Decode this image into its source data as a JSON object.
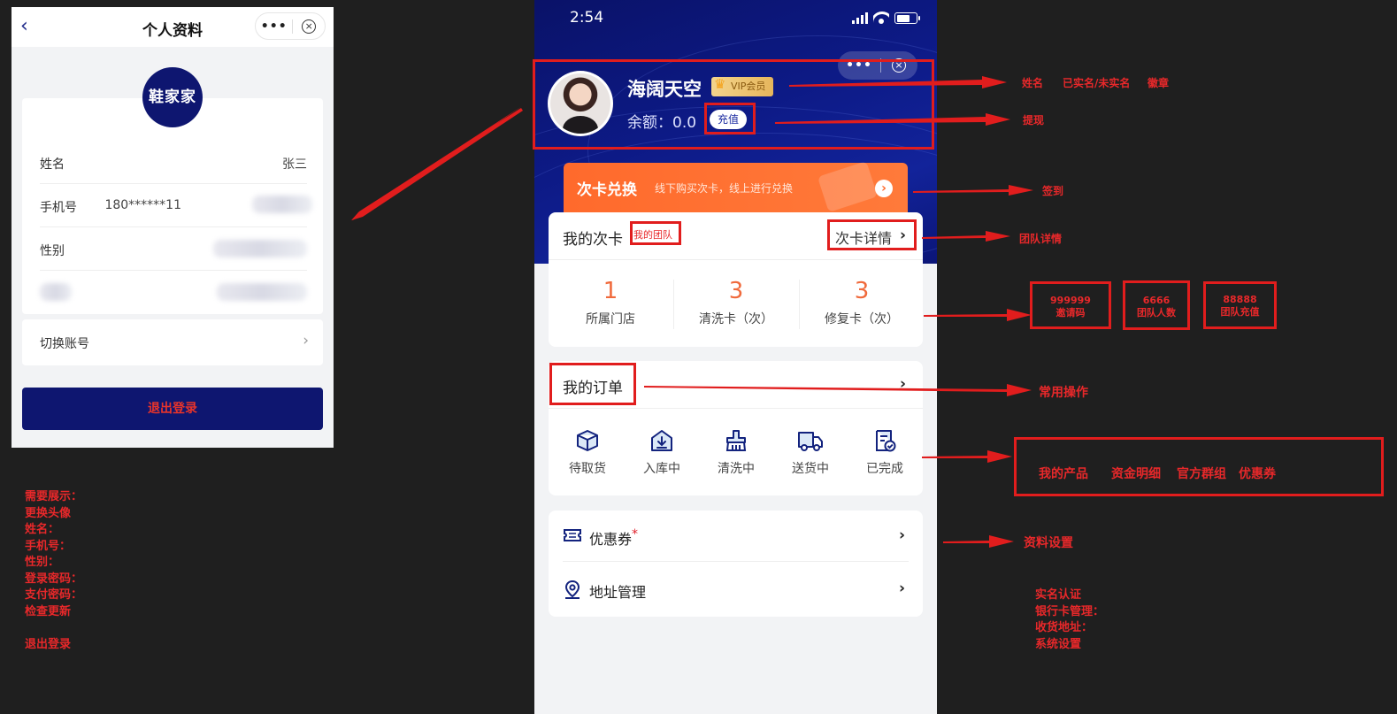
{
  "left_phone": {
    "nav_title": "个人资料",
    "capsule_dots": "•••",
    "capsule_close": "×",
    "back_icon": "‹",
    "logo_text": "鞋家家",
    "fields": [
      {
        "label": "姓名",
        "value": "张三"
      },
      {
        "label": "手机号",
        "value": "180******11"
      },
      {
        "label": "性别",
        "value": ""
      },
      {
        "label": "",
        "value": ""
      }
    ],
    "switch_account": "切换账号",
    "switch_chevron": "›",
    "logout": "退出登录"
  },
  "right_phone": {
    "status": {
      "time": "2:54"
    },
    "capsule_dots": "•••",
    "capsule_close": "×",
    "user": {
      "name": "海阔天空",
      "vip_badge": "VIP会员",
      "balance_label": "余额：",
      "balance_value": "0.0",
      "recharge_button": "充值"
    },
    "promo": {
      "title": "次卡兑换",
      "subtitle": "线下购买次卡，线上进行兑换",
      "go": "›"
    },
    "cards": {
      "title": "我的次卡",
      "detail_link": "次卡详情",
      "stats": [
        {
          "value": "1",
          "label": "所属门店"
        },
        {
          "value": "3",
          "label": "清洗卡（次）"
        },
        {
          "value": "3",
          "label": "修复卡（次）"
        }
      ]
    },
    "orders": {
      "title": "我的订单",
      "items": [
        {
          "label": "待取货",
          "icon": "box-icon"
        },
        {
          "label": "入库中",
          "icon": "warehouse-icon"
        },
        {
          "label": "清洗中",
          "icon": "cleaning-brush-icon"
        },
        {
          "label": "送货中",
          "icon": "delivery-truck-icon"
        },
        {
          "label": "已完成",
          "icon": "completed-doc-icon"
        }
      ]
    },
    "menu": [
      {
        "label": "优惠券",
        "badge": "*",
        "icon": "coupon-icon"
      },
      {
        "label": "地址管理",
        "icon": "location-pin-icon"
      }
    ]
  },
  "annotations": {
    "my_team": "我的团队",
    "row1": [
      "姓名",
      "已实名/未实名",
      "徽章"
    ],
    "withdraw": "提现",
    "checkin": "签到",
    "team_detail": "团队详情",
    "team_boxes": [
      {
        "value": "999999",
        "label": "邀请码"
      },
      {
        "value": "6666",
        "label": "团队人数"
      },
      {
        "value": "88888",
        "label": "团队充值"
      }
    ],
    "common_ops": "常用操作",
    "product_links": [
      "我的产品",
      "资金明细",
      "官方群组",
      "优惠券"
    ],
    "profile_settings": "资料设置",
    "settings_list": [
      "实名认证",
      "银行卡管理：",
      "收货地址：",
      "系统设置"
    ],
    "left_notes": [
      "需要展示：",
      "更换头像",
      "姓名：",
      "手机号：",
      "性别：",
      "登录密码：",
      "支付密码：",
      "检查更新",
      "",
      "退出登录"
    ],
    "colors": {
      "annotation_red": "#e11d1d",
      "brand_navy": "#0e1670",
      "promo_orange": "#ff6a2c"
    }
  }
}
